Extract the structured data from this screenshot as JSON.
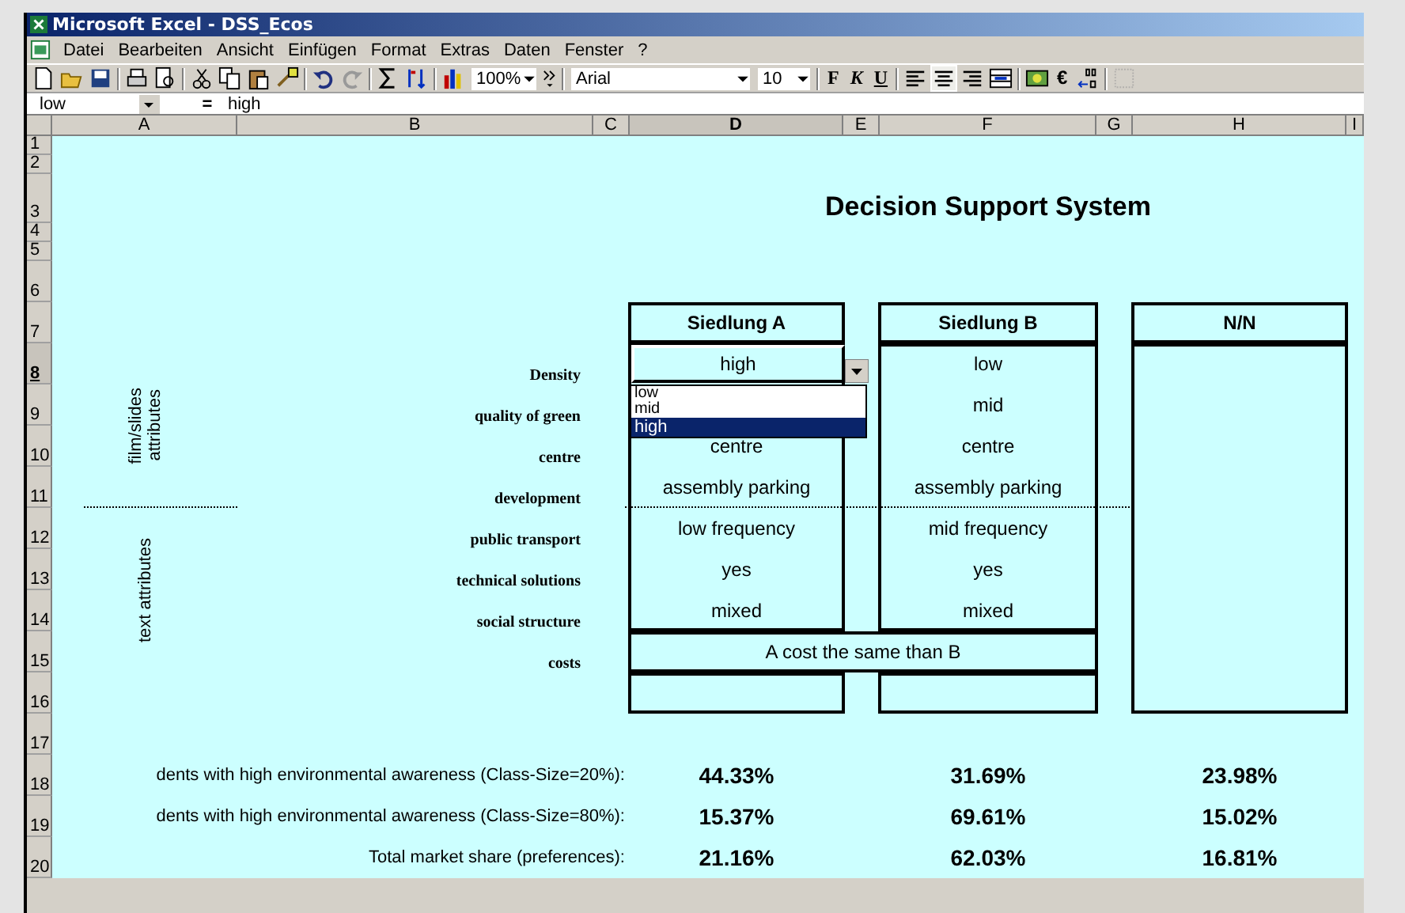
{
  "window": {
    "title": "Microsoft Excel - DSS_Ecos"
  },
  "menu": [
    "Datei",
    "Bearbeiten",
    "Ansicht",
    "Einfügen",
    "Format",
    "Extras",
    "Daten",
    "Fenster",
    "?"
  ],
  "toolbar": {
    "zoom": "100%",
    "font": "Arial",
    "size": "10",
    "bold": "F",
    "italic": "K",
    "underline": "U",
    "euro": "€",
    "align_buttons": [
      {
        "selected": false
      },
      {
        "selected": true
      },
      {
        "selected": false
      }
    ]
  },
  "formula_bar": {
    "name_box": "low",
    "equals": "=",
    "value": "high"
  },
  "column_headers": [
    {
      "label": "A",
      "selected": false
    },
    {
      "label": "B",
      "selected": false
    },
    {
      "label": "C",
      "selected": false
    },
    {
      "label": "D",
      "selected": true
    },
    {
      "label": "E",
      "selected": false
    },
    {
      "label": "F",
      "selected": false
    },
    {
      "label": "G",
      "selected": false
    },
    {
      "label": "H",
      "selected": false
    },
    {
      "label": "I",
      "selected": false
    }
  ],
  "row_headers": [
    {
      "label": "1",
      "selected": false
    },
    {
      "label": "2",
      "selected": false
    },
    {
      "label": "3",
      "selected": false
    },
    {
      "label": "4",
      "selected": false
    },
    {
      "label": "5",
      "selected": false
    },
    {
      "label": "6",
      "selected": false
    },
    {
      "label": "7",
      "selected": false
    },
    {
      "label": "8",
      "selected": true
    },
    {
      "label": "9",
      "selected": false
    },
    {
      "label": "10",
      "selected": false
    },
    {
      "label": "11",
      "selected": false
    },
    {
      "label": "12",
      "selected": false
    },
    {
      "label": "13",
      "selected": false
    },
    {
      "label": "14",
      "selected": false
    },
    {
      "label": "15",
      "selected": false
    },
    {
      "label": "16",
      "selected": false
    },
    {
      "label": "17",
      "selected": false
    },
    {
      "label": "18",
      "selected": false
    },
    {
      "label": "19",
      "selected": false
    },
    {
      "label": "20",
      "selected": false
    }
  ],
  "sheet": {
    "title": "Decision Support System",
    "group_labels": [
      "film/slides\nattributes",
      "text attributes"
    ],
    "attributes": [
      "Density",
      "quality of green",
      "centre",
      "development",
      "public transport",
      "technical solutions",
      "social structure",
      "costs"
    ],
    "options": [
      {
        "name": "Siedlung A",
        "active_value": "high",
        "values": [
          "centre",
          "assembly parking",
          "low frequency",
          "yes",
          "mixed"
        ]
      },
      {
        "name": "Siedlung B",
        "values": [
          "low",
          "mid",
          "centre",
          "assembly parking",
          "mid frequency",
          "yes",
          "mixed"
        ]
      },
      {
        "name": "N/N"
      }
    ],
    "cost_text": "A cost the same than B",
    "dropdown": [
      {
        "label": "low",
        "selected": false
      },
      {
        "label": "mid",
        "selected": false
      },
      {
        "label": "high",
        "selected": true
      }
    ],
    "results": [
      {
        "label": "dents with high environmental awareness (Class-Size=20%):",
        "values": [
          "44.33%",
          "31.69%",
          "23.98%"
        ]
      },
      {
        "label": "dents with high environmental awareness (Class-Size=80%):",
        "values": [
          "15.37%",
          "69.61%",
          "15.02%"
        ]
      },
      {
        "label": "Total market share (preferences):",
        "values": [
          "21.16%",
          "62.03%",
          "16.81%"
        ]
      }
    ]
  }
}
